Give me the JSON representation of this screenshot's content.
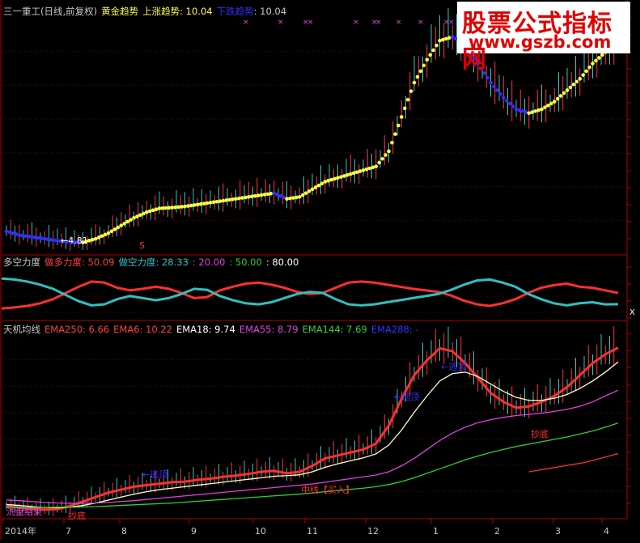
{
  "colors": {
    "bg": "#000000",
    "frame": "#b00000",
    "grid": "#6a0000",
    "text": "#c8c8c8",
    "yellow": "#ffff40",
    "blue": "#3030ff",
    "red": "#ff3030",
    "cyan": "#30c0c0",
    "white": "#ffffff",
    "magenta": "#e040e0",
    "green": "#30d030"
  },
  "main_header": {
    "stock": "三一重工(日线,前复权)",
    "gold_trend_label": "黄金趋势",
    "up_trend": "上涨趋势: 10.04",
    "down_trend": "下跌趋势",
    "down_value": ": 10.04"
  },
  "main_annotation": "←4.81",
  "buy_marker": "S",
  "top_marks": "×",
  "osc_header": {
    "name": "多空力度",
    "long_label": "做多力度: 50.09",
    "short_label": "做空力度: 28.33",
    "v20": ": 20.00",
    "v50": ": 50.00",
    "v80": ": 80.00"
  },
  "osc_right_tag": "X",
  "ema_header": {
    "name": "天机均线",
    "ema250": "EMA250: 6.66",
    "ema6": "EMA6: 10.22",
    "ema18": "EMA18: 9.74",
    "ema55": "EMA55: 8.79",
    "ema144": "EMA144: 7.69",
    "ema288": "EMA288: -"
  },
  "ema_annotations": {
    "escape_top_1": "←逃顶",
    "escape_top_2": "←逃顶",
    "escape_top_3": "←逃顶",
    "bottom_1": "抄底",
    "bottom_2": "抄底",
    "washout": "洗盘结束",
    "midline_buy": "中线【买入】"
  },
  "x_axis": [
    "2014年",
    "7",
    "8",
    "9",
    "10",
    "11",
    "12",
    "1",
    "2",
    "3",
    "4"
  ],
  "watermark": {
    "line1": "股票公式指标网",
    "line2": "www.gszb.com"
  },
  "chart_data": [
    {
      "type": "line",
      "title": "黄金趋势",
      "series": [
        {
          "name": "上涨趋势",
          "values": [
            5.1,
            5.0,
            4.95,
            4.9,
            4.85,
            4.82,
            4.81,
            4.9,
            5.05,
            5.25,
            5.45,
            5.6,
            5.7,
            5.72,
            5.75,
            5.8,
            5.85,
            5.9,
            5.95,
            6.0,
            6.05,
            6.1,
            5.95,
            6.0,
            6.2,
            6.4,
            6.5,
            6.6,
            6.7,
            6.8,
            7.2,
            8.1,
            9.0,
            9.6,
            10.1,
            10.2,
            10.0,
            9.5,
            9.0,
            8.6,
            8.3,
            8.2,
            8.3,
            8.5,
            8.8,
            9.1,
            9.5,
            9.8,
            10.04
          ]
        }
      ],
      "ylim": [
        4.5,
        10.7
      ]
    },
    {
      "type": "line",
      "title": "多空力度",
      "series": [
        {
          "name": "做多力度",
          "values": [
            20,
            22,
            25,
            30,
            38,
            50,
            62,
            72,
            70,
            60,
            55,
            58,
            62,
            58,
            50,
            40,
            42,
            55,
            62,
            68,
            70,
            66,
            60,
            52,
            48,
            50,
            60,
            70,
            72,
            70,
            66,
            62,
            58,
            55,
            52,
            45,
            35,
            28,
            25,
            30,
            38,
            50,
            60,
            65,
            68,
            62,
            60,
            55,
            50.09
          ]
        },
        {
          "name": "做空力度",
          "values": [
            78,
            76,
            72,
            66,
            58,
            46,
            34,
            26,
            28,
            38,
            44,
            40,
            36,
            40,
            48,
            58,
            56,
            44,
            36,
            30,
            28,
            32,
            40,
            48,
            52,
            50,
            38,
            28,
            26,
            28,
            32,
            36,
            40,
            44,
            48,
            56,
            66,
            74,
            76,
            70,
            62,
            48,
            38,
            30,
            26,
            30,
            32,
            28,
            28.33
          ]
        }
      ],
      "ylim": [
        0,
        100
      ]
    },
    {
      "type": "line",
      "title": "天机均线",
      "series": [
        {
          "name": "EMA6",
          "values": [
            4.9,
            4.85,
            4.8,
            4.78,
            4.8,
            4.9,
            5.05,
            5.2,
            5.35,
            5.45,
            5.55,
            5.6,
            5.65,
            5.7,
            5.72,
            5.78,
            5.82,
            5.88,
            5.92,
            5.98,
            6.05,
            6.08,
            6.0,
            6.05,
            6.25,
            6.5,
            6.6,
            6.7,
            6.8,
            7.0,
            7.6,
            8.5,
            9.3,
            9.8,
            10.2,
            10.1,
            9.7,
            9.2,
            8.7,
            8.4,
            8.2,
            8.25,
            8.4,
            8.6,
            8.9,
            9.3,
            9.7,
            10.0,
            10.22
          ]
        },
        {
          "name": "EMA18",
          "values": [
            4.95,
            4.92,
            4.88,
            4.85,
            4.84,
            4.86,
            4.92,
            5.0,
            5.1,
            5.2,
            5.3,
            5.38,
            5.45,
            5.5,
            5.55,
            5.6,
            5.65,
            5.7,
            5.75,
            5.8,
            5.85,
            5.9,
            5.92,
            5.95,
            6.05,
            6.2,
            6.32,
            6.42,
            6.52,
            6.65,
            6.95,
            7.45,
            8.05,
            8.6,
            9.1,
            9.35,
            9.4,
            9.25,
            9.0,
            8.75,
            8.55,
            8.45,
            8.45,
            8.52,
            8.65,
            8.85,
            9.1,
            9.4,
            9.74
          ]
        },
        {
          "name": "EMA55",
          "values": [
            5.1,
            5.08,
            5.05,
            5.02,
            5.0,
            4.99,
            4.99,
            5.0,
            5.02,
            5.05,
            5.08,
            5.12,
            5.16,
            5.2,
            5.24,
            5.28,
            5.32,
            5.36,
            5.4,
            5.44,
            5.48,
            5.52,
            5.56,
            5.6,
            5.64,
            5.7,
            5.76,
            5.82,
            5.88,
            5.94,
            6.05,
            6.25,
            6.5,
            6.8,
            7.1,
            7.35,
            7.55,
            7.7,
            7.8,
            7.88,
            7.94,
            7.98,
            8.02,
            8.08,
            8.15,
            8.25,
            8.4,
            8.6,
            8.79
          ]
        },
        {
          "name": "EMA144",
          "values": [
            4.85,
            4.85,
            4.85,
            4.85,
            4.86,
            4.86,
            4.87,
            4.88,
            4.9,
            4.92,
            4.94,
            4.96,
            4.98,
            5.0,
            5.03,
            5.06,
            5.09,
            5.12,
            5.15,
            5.18,
            5.21,
            5.24,
            5.27,
            5.3,
            5.34,
            5.38,
            5.42,
            5.46,
            5.5,
            5.55,
            5.62,
            5.72,
            5.85,
            6.0,
            6.15,
            6.3,
            6.45,
            6.58,
            6.7,
            6.8,
            6.9,
            6.98,
            7.06,
            7.14,
            7.22,
            7.32,
            7.42,
            7.55,
            7.69
          ]
        },
        {
          "name": "EMA250",
          "values": [
            6.05,
            6.1,
            6.15,
            6.2,
            6.25,
            6.3,
            6.35,
            6.42,
            6.5,
            6.58,
            6.66
          ]
        }
      ],
      "ylim": [
        4.5,
        10.7
      ]
    }
  ]
}
